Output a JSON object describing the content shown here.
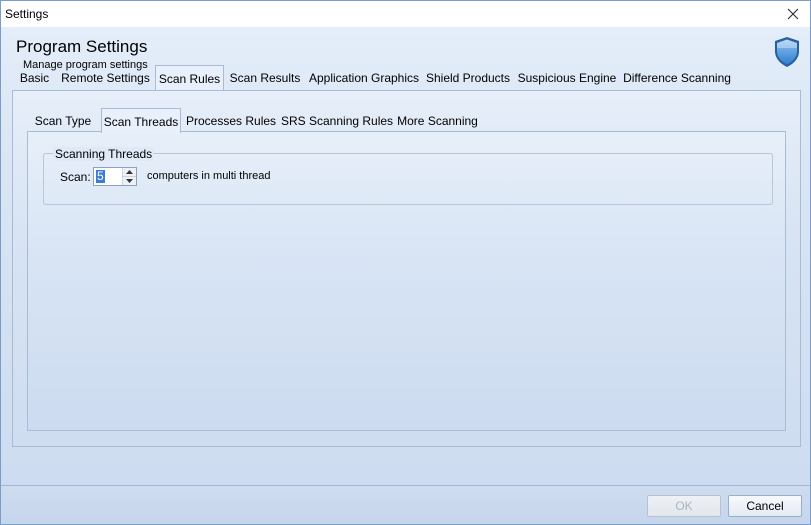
{
  "window": {
    "title": "Settings"
  },
  "header": {
    "title": "Program Settings",
    "subtitle": "Manage program settings"
  },
  "main_tabs": [
    {
      "label": "Basic"
    },
    {
      "label": "Remote Settings"
    },
    {
      "label": "Scan Rules",
      "active": true
    },
    {
      "label": "Scan Results"
    },
    {
      "label": "Application Graphics"
    },
    {
      "label": "Shield Products"
    },
    {
      "label": "Suspicious Engine"
    },
    {
      "label": "Difference Scanning"
    }
  ],
  "sub_tabs": [
    {
      "label": "Scan Type"
    },
    {
      "label": "Scan Threads",
      "active": true
    },
    {
      "label": "Processes Rules"
    },
    {
      "label": "SRS Scanning Rules"
    },
    {
      "label": "More Scanning"
    }
  ],
  "scanning_threads": {
    "legend": "Scanning Threads",
    "scan_label": "Scan:",
    "value": "5",
    "after_label": "computers in multi thread"
  },
  "footer": {
    "ok_label": "OK",
    "ok_disabled": true,
    "cancel_label": "Cancel"
  },
  "icons": {
    "close": "close-icon",
    "shield": "shield-icon",
    "spin_up": "spin-up-arrow-icon",
    "spin_down": "spin-down-arrow-icon"
  }
}
